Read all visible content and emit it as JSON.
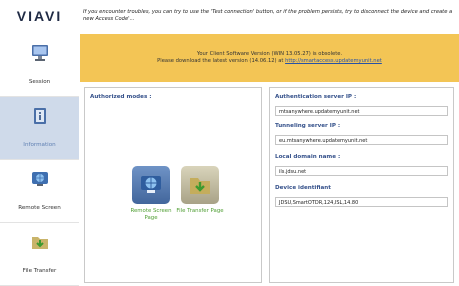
{
  "logo": "VIAVI",
  "top_message": "If you encounter troubles, you can try to use the 'Test connection' button, or if the problem persists, try to disconnect the device and create a new Access Code'...",
  "sidebar": {
    "items": [
      {
        "label": "Session"
      },
      {
        "label": "Information"
      },
      {
        "label": "Remote Screen"
      },
      {
        "label": "File Transfer"
      }
    ]
  },
  "banner": {
    "line1": "Your Client Software Version (WIN 13.05.27) is obsolete.",
    "line2_prefix": "Please download the latest version (14.06.12) at ",
    "link": "http://smartaccess.updatemyunit.net"
  },
  "authorized": {
    "title": "Authorized modes :",
    "remote_label": "Remote Screen Page",
    "file_label": "File Transfer Page"
  },
  "details": {
    "auth_label": "Authentication server IP :",
    "auth_value": "mtsanywhere.updatemyunit.net",
    "tunnel_label": "Tunneling server IP :",
    "tunnel_value": "eu.mtsanywhere.updatemyunit.net",
    "domain_label": "Local domain name :",
    "domain_value": "ils.jdsu.net",
    "device_label": "Device identifiant",
    "device_value": "JDSU,SmartOTDR,124,ISL,14.80"
  },
  "colors": {
    "banner": "#f3c555",
    "accent": "#34508a",
    "active_nav": "#cfdaea",
    "tile_label": "#4f9e33"
  }
}
